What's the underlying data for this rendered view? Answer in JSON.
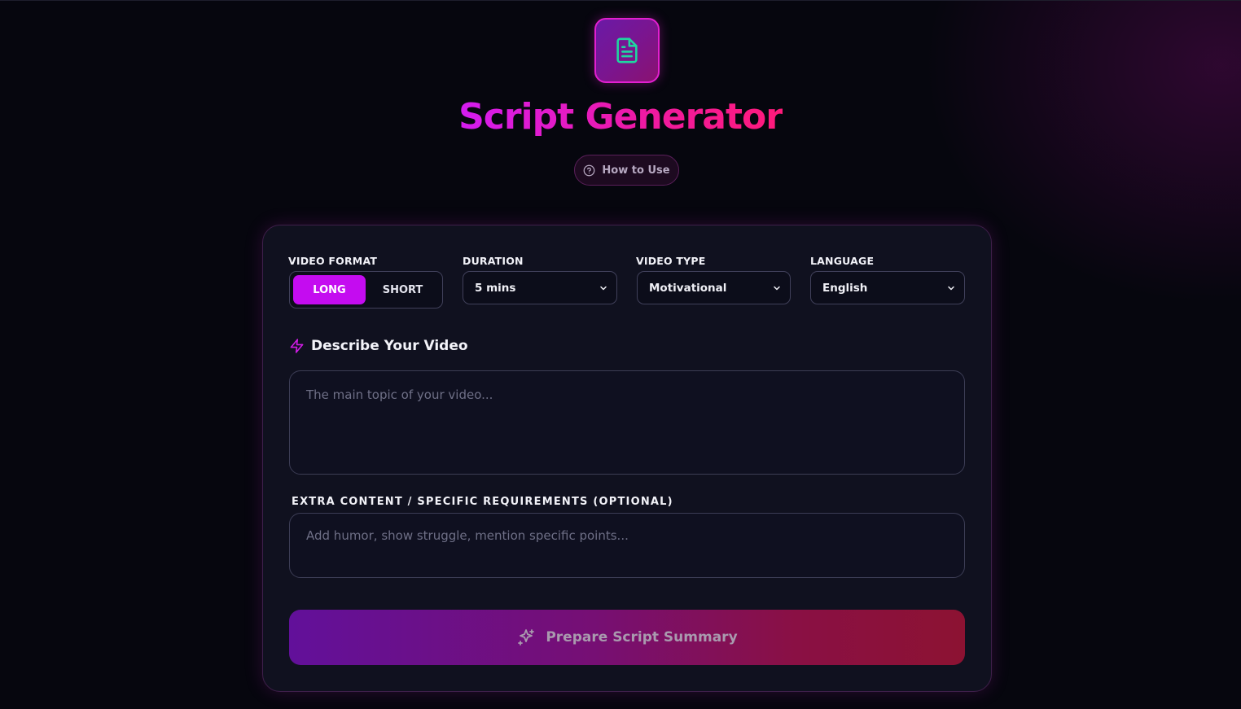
{
  "header": {
    "logo_icon": "document-icon",
    "title": "Script Generator",
    "how_to_use": "How to Use"
  },
  "form": {
    "video_format": {
      "label": "VIDEO FORMAT",
      "options": [
        "LONG",
        "SHORT"
      ],
      "selected": "LONG"
    },
    "duration": {
      "label": "DURATION",
      "value": "5 mins"
    },
    "video_type": {
      "label": "VIDEO TYPE",
      "value": "Motivational"
    },
    "language": {
      "label": "LANGUAGE",
      "value": "English"
    },
    "describe": {
      "heading": "Describe Your Video",
      "placeholder": "The main topic of your video..."
    },
    "extra": {
      "label": "EXTRA CONTENT / SPECIFIC REQUIREMENTS (OPTIONAL)",
      "placeholder": "Add humor, show struggle, mention specific points..."
    },
    "submit_label": "Prepare Script Summary"
  },
  "colors": {
    "accent": "#c40cf0",
    "title_gradient_start": "#d41cf0",
    "title_gradient_end": "#ff1a7a",
    "icon_green": "#1fd6a0"
  }
}
